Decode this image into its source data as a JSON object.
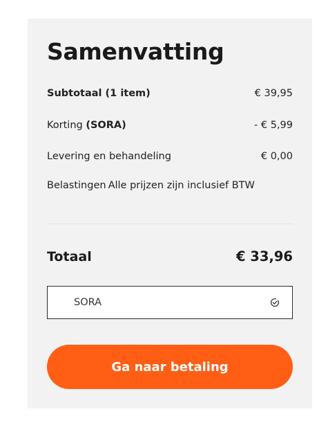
{
  "summary": {
    "title": "Samenvatting",
    "subtotal_label": "Subtotaal (1 item)",
    "subtotal_value": "€ 39,95",
    "discount_label": "Korting",
    "discount_code": "(SORA)",
    "discount_value": "- € 5,99",
    "shipping_label": "Levering en behandeling",
    "shipping_value": "€ 0,00",
    "tax_label": "Belastingen",
    "tax_note": "Alle prijzen zijn inclusief BTW",
    "total_label": "Totaal",
    "total_value": "€ 33,96"
  },
  "coupon": {
    "code": "SORA",
    "status_icon": "check-circle-icon"
  },
  "checkout": {
    "button_label": "Ga naar betaling"
  },
  "colors": {
    "panel_bg": "#f2f2f2",
    "accent": "#ff5e14"
  }
}
